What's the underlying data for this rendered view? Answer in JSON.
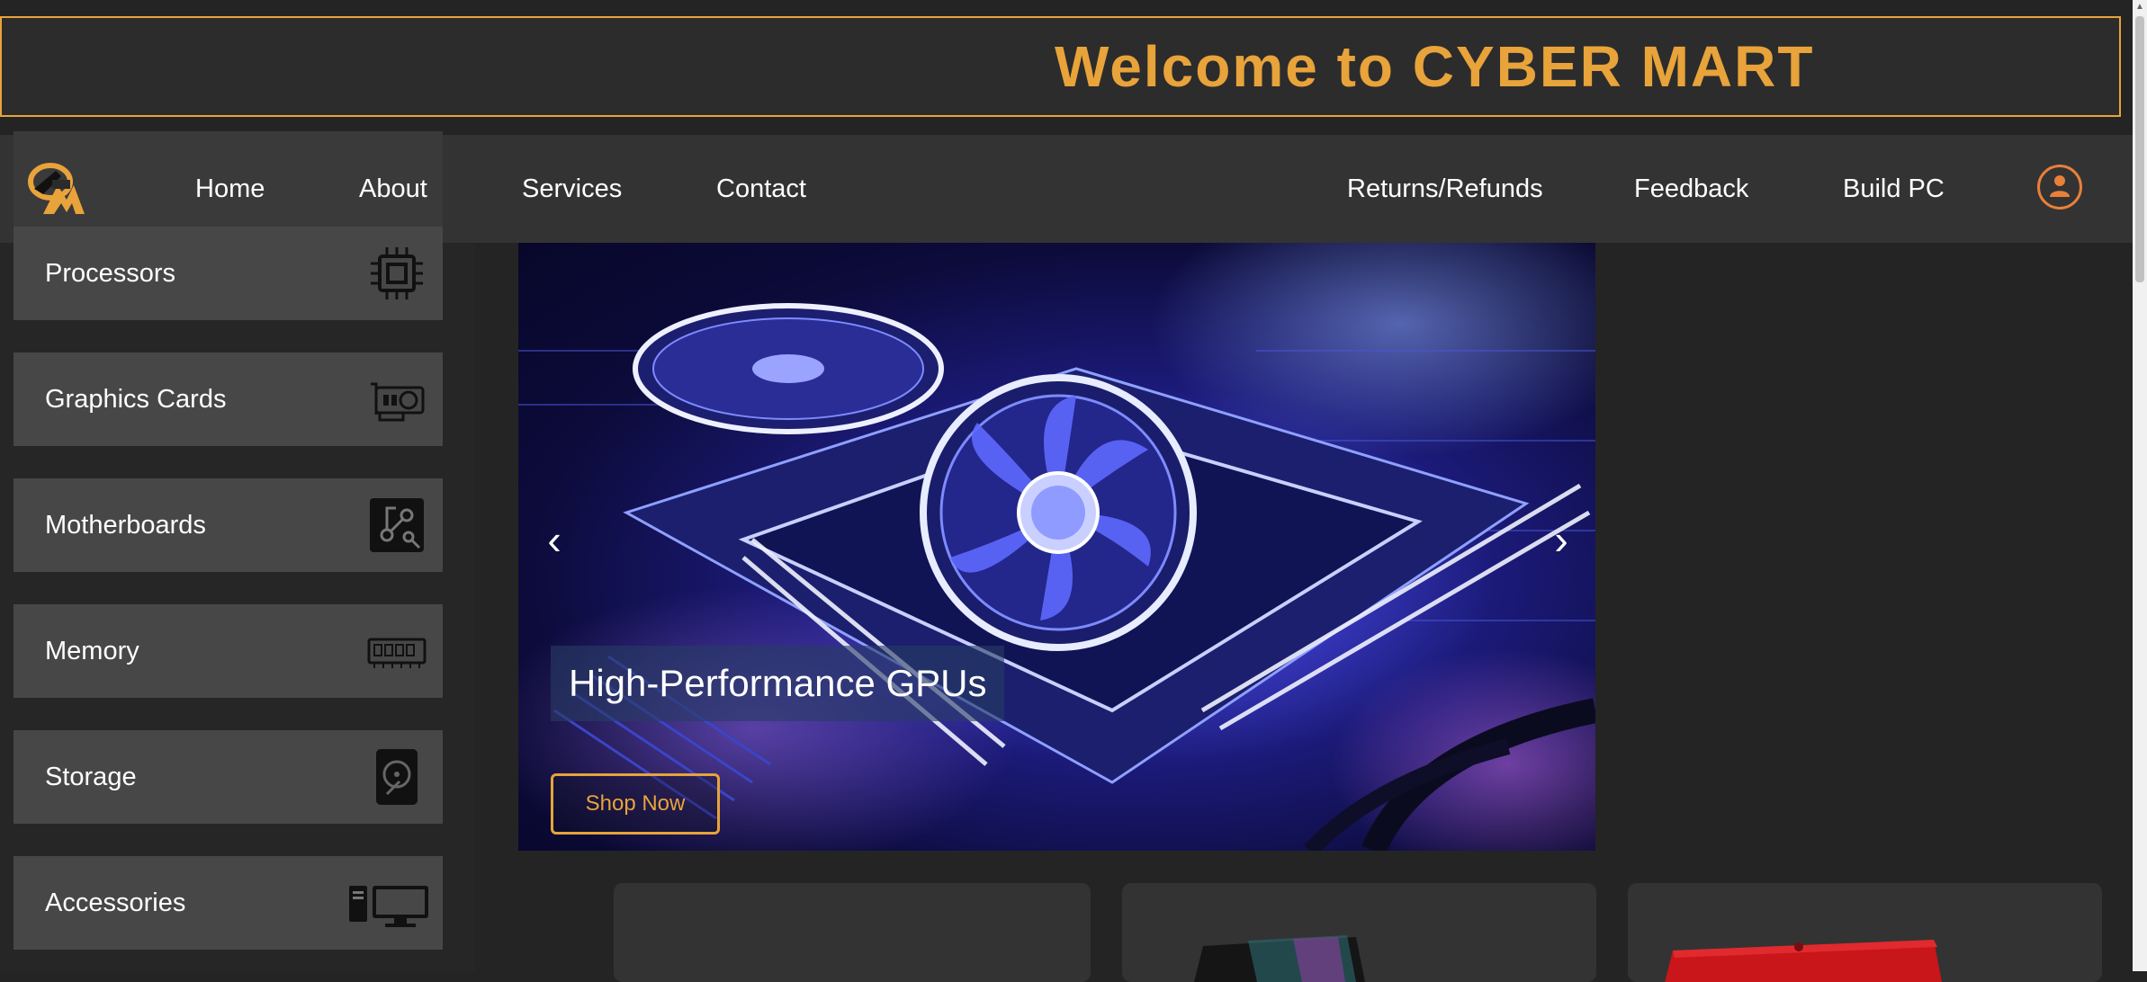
{
  "banner": {
    "title": "Welcome to CYBER MART"
  },
  "nav": {
    "logo_icon": "cyber-mart-logo",
    "left_links": [
      "Home",
      "About",
      "Services",
      "Contact"
    ],
    "right_links": [
      "Returns/Refunds",
      "Feedback",
      "Build PC"
    ],
    "user_icon": "user-icon"
  },
  "sidebar": {
    "items": [
      {
        "label": "Processors",
        "icon": "cpu-icon"
      },
      {
        "label": "Graphics Cards",
        "icon": "gpu-icon"
      },
      {
        "label": "Motherboards",
        "icon": "motherboard-icon"
      },
      {
        "label": "Memory",
        "icon": "memory-icon"
      },
      {
        "label": "Storage",
        "icon": "hard-drive-icon"
      },
      {
        "label": "Accessories",
        "icon": "desktop-icon"
      }
    ]
  },
  "hero": {
    "caption": "High-Performance GPUs",
    "button": "Shop Now",
    "prev_icon": "chevron-left-icon",
    "next_icon": "chevron-right-icon"
  },
  "colors": {
    "accent": "#e8a33a",
    "user_icon": "#e8803a",
    "background": "#242424",
    "navbar": "#333333",
    "sidebar_item": "#474747"
  }
}
